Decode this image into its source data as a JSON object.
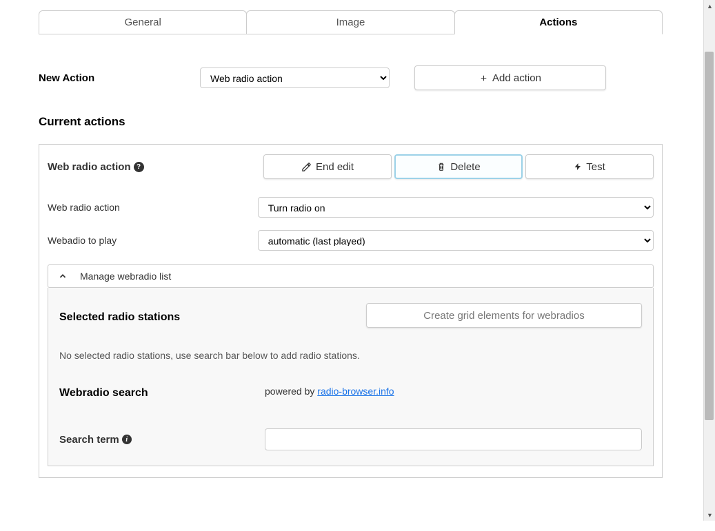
{
  "tabs": {
    "general": "General",
    "image": "Image",
    "actions": "Actions"
  },
  "newAction": {
    "label": "New Action",
    "selectValue": "Web radio action",
    "addButton": "Add action"
  },
  "currentActionsHeading": "Current actions",
  "actionPanel": {
    "title": "Web radio action",
    "buttons": {
      "endEdit": "End edit",
      "delete": "Delete",
      "test": "Test"
    },
    "fields": {
      "radioActionLabel": "Web radio action",
      "radioActionValue": "Turn radio on",
      "webradioLabel": "Webadio to play",
      "webradioValue": "automatic (last played)"
    },
    "collapse": {
      "header": "Manage webradio list",
      "selectedHeading": "Selected radio stations",
      "createGridBtn": "Create grid elements for webradios",
      "emptyMsg": "No selected radio stations, use search bar below to add radio stations.",
      "searchHeading": "Webradio search",
      "poweredBy": "powered by ",
      "poweredLink": "radio-browser.info",
      "searchTermLabel": "Search term"
    }
  }
}
